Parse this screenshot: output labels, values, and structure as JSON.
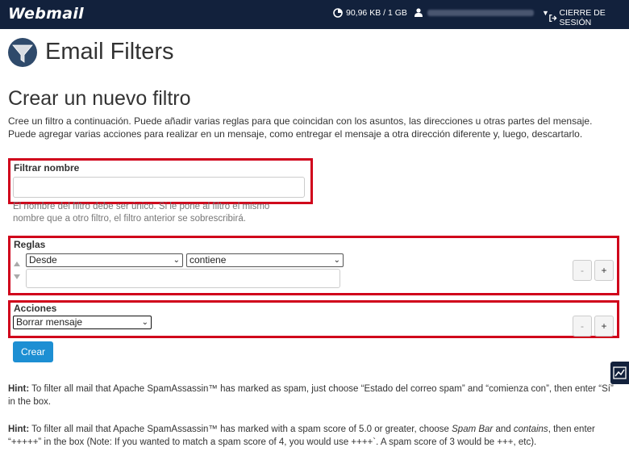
{
  "topbar": {
    "logo": "Webmail",
    "quota": "90,96 KB / 1 GB",
    "logout": "CIERRE DE SESIÓN"
  },
  "header": {
    "title": "Email Filters"
  },
  "form": {
    "section_title": "Crear un nuevo filtro",
    "description": "Cree un filtro a continuación. Puede añadir varias reglas para que coincidan con los asuntos, las direcciones u otras partes del mensaje. Puede agregar varias acciones para realizar en un mensaje, como entregar el mensaje a otra dirección diferente y, luego, descartarlo.",
    "filter_name_label": "Filtrar nombre",
    "filter_name_value": "",
    "filter_name_help": "El nombre del filtro debe ser único. Si le pone al filtro el mismo nombre que a otro filtro, el filtro anterior se sobrescribirá.",
    "rules_label": "Reglas",
    "rule_field": "Desde",
    "rule_operator": "contiene",
    "rule_value": "",
    "actions_label": "Acciones",
    "action": "Borrar mensaje",
    "minus": "-",
    "plus": "+",
    "create_button": "Crear"
  },
  "hints": [
    {
      "label": "Hint:",
      "text": " To filter all mail that Apache SpamAssassin™ has marked as spam, just choose “Estado del correo spam” and “comienza con”, then enter “Sí” in the box."
    },
    {
      "label": "Hint:",
      "text1": " To filter all mail that Apache SpamAssassin™ has marked with a spam score of 5.0 or greater, choose ",
      "em1": "Spam Bar",
      "text2": " and ",
      "em2": "contains",
      "text3": ", then enter “+++++” in the box (Note: If you wanted to match a spam score of 4, you would use ++++`. A spam score of 3 would be +++, etc)."
    }
  ]
}
